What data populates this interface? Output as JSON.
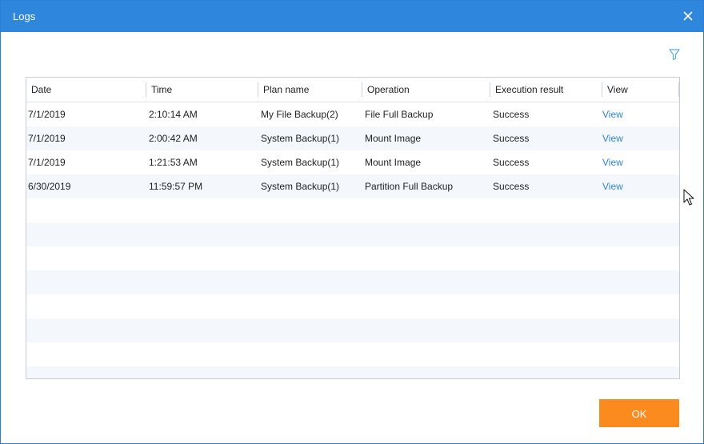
{
  "window": {
    "title": "Logs"
  },
  "table": {
    "columns": [
      "Date",
      "Time",
      "Plan name",
      "Operation",
      "Execution result",
      "View"
    ],
    "rows": [
      {
        "date": "7/1/2019",
        "time": "2:10:14 AM",
        "plan": "My File Backup(2)",
        "operation": "File Full Backup",
        "result": "Success",
        "view": "View"
      },
      {
        "date": "7/1/2019",
        "time": "2:00:42 AM",
        "plan": "System Backup(1)",
        "operation": "Mount Image",
        "result": "Success",
        "view": "View"
      },
      {
        "date": "7/1/2019",
        "time": "1:21:53 AM",
        "plan": "System Backup(1)",
        "operation": "Mount Image",
        "result": "Success",
        "view": "View"
      },
      {
        "date": "6/30/2019",
        "time": "11:59:57 PM",
        "plan": "System Backup(1)",
        "operation": "Partition Full Backup",
        "result": "Success",
        "view": "View"
      }
    ]
  },
  "footer": {
    "ok_label": "OK"
  },
  "colors": {
    "titlebar": "#2f86dd",
    "link": "#2f86dd",
    "ok_button": "#fb8b1e",
    "alt_row": "#f4f7fb"
  },
  "icons": {
    "close": "close-icon",
    "filter": "filter-icon",
    "cursor": "mouse-pointer-icon"
  }
}
